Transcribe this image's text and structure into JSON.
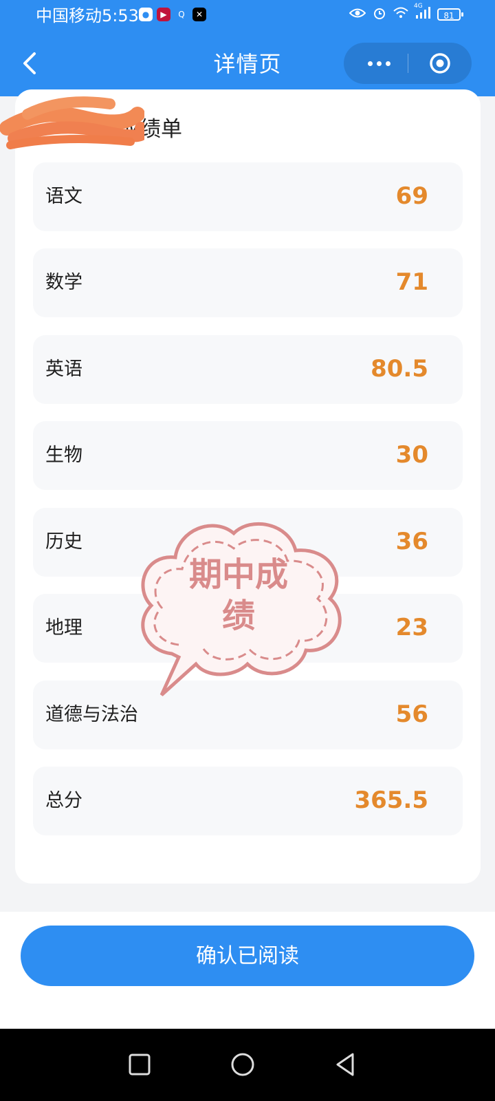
{
  "status_bar": {
    "carrier_time": "中国移动5:53",
    "network": "4G",
    "battery": "81"
  },
  "nav": {
    "title": "详情页"
  },
  "card": {
    "title": "成绩单",
    "rows": [
      {
        "subject": "语文",
        "score": "69"
      },
      {
        "subject": "数学",
        "score": "71"
      },
      {
        "subject": "英语",
        "score": "80.5"
      },
      {
        "subject": "生物",
        "score": "30"
      },
      {
        "subject": "历史",
        "score": "36"
      },
      {
        "subject": "地理",
        "score": "23"
      },
      {
        "subject": "道德与法治",
        "score": "56"
      },
      {
        "subject": "总分",
        "score": "365.5"
      }
    ]
  },
  "stamp": {
    "line1": "期中成",
    "line2": "绩"
  },
  "footer": {
    "confirm_label": "确认已阅读"
  },
  "colors": {
    "primary": "#2e8ef2",
    "score": "#e4892c",
    "stamp": "#d98b8b"
  }
}
